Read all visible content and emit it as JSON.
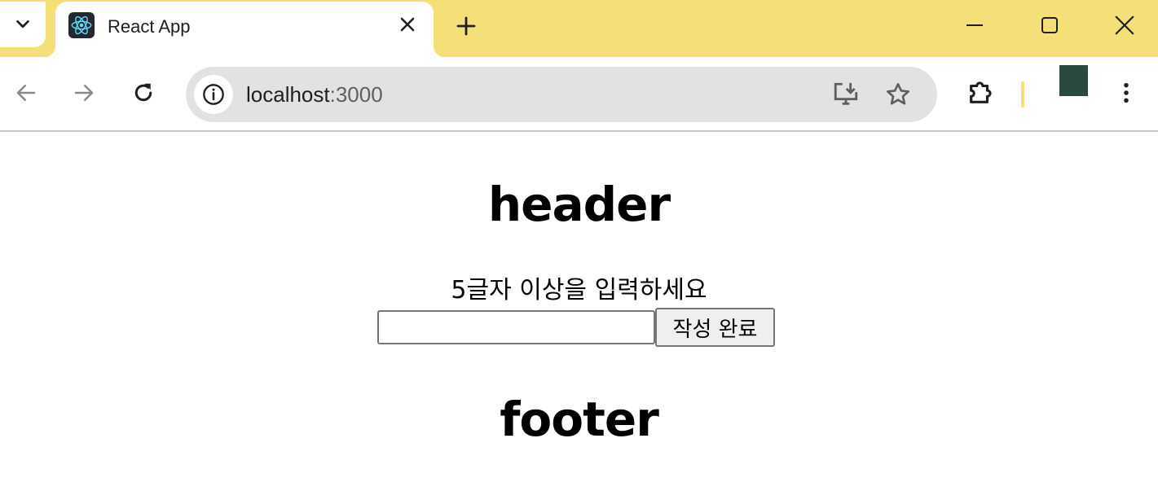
{
  "browser": {
    "tab": {
      "title": "React App",
      "favicon_icon": "react-logo-icon",
      "close_icon": "close-icon"
    },
    "tab_search_icon": "chevron-down-icon",
    "new_tab_icon": "plus-icon",
    "window_controls": [
      "minimize-icon",
      "maximize-icon",
      "close-window-icon"
    ],
    "toolbar": {
      "back_icon": "arrow-left-icon",
      "forward_icon": "arrow-right-icon",
      "reload_icon": "reload-icon",
      "site_info_icon": "info-icon",
      "url_host": "localhost",
      "url_port": ":3000",
      "install_icon": "install-app-icon",
      "bookmark_icon": "star-icon",
      "extensions_icon": "puzzle-icon",
      "menu_icon": "kebab-menu-icon"
    },
    "colors": {
      "tab_strip": "#f4df78",
      "omnibox": "#e2e2e2",
      "profile": "#2a4a3e"
    }
  },
  "page": {
    "header": "header",
    "prompt": "5글자 이상을 입력하세요",
    "input_value": "",
    "submit_label": "작성 완료",
    "footer": "footer"
  }
}
